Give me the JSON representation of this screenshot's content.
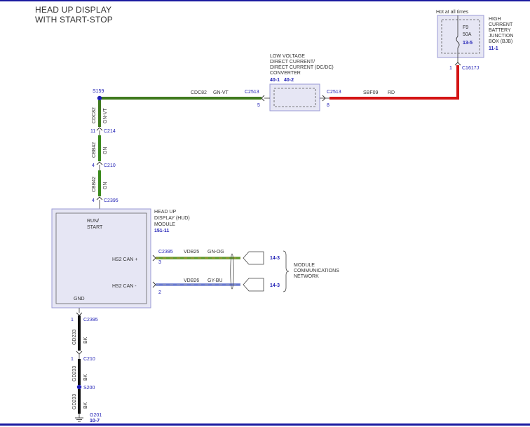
{
  "title": {
    "line1": "HEAD UP DISPLAY",
    "line2": "WITH START-STOP"
  },
  "colors": {
    "frame": "#1a1aa0",
    "component_fill": "#e6e6f4",
    "component_border": "#9a9ad6",
    "ref_text": "#1c1cb4",
    "wire_gn_vt": "#3f7a1e",
    "wire_gn": "#3a8a1c",
    "wire_rd": "#d41414",
    "wire_bk": "#111111",
    "wire_gy_bu": "#6a7ad0",
    "wire_gn_og": "#5f9a2c"
  },
  "bjb": {
    "hot_label": "Hot at all times",
    "fuse": "F9",
    "rating": "50A",
    "fuse_ref": "13-5",
    "name_lines": [
      "HIGH",
      "CURRENT",
      "BATTERY",
      "JUNCTION",
      "BOX (BJB)"
    ],
    "ref": "11-1",
    "pin": "1",
    "connector": "C1617J"
  },
  "converter": {
    "name_lines": [
      "LOW VOLTAGE",
      "DIRECT CURRENT/",
      "DIRECT CURRENT (DC/DC)",
      "CONVERTER"
    ],
    "ref1": "40-1",
    "ref2": "40-2",
    "left_connector": "C2513",
    "left_pin": "5",
    "right_connector": "C2513",
    "right_pin": "8"
  },
  "wires": {
    "red": {
      "circuit": "SBF09",
      "color": "RD"
    },
    "top": {
      "circuit": "CDC82",
      "color": "GN-VT"
    },
    "v1": {
      "circuit": "CDC82",
      "color": "GN-VT"
    },
    "v2": {
      "circuit": "CBB42",
      "color": "GN"
    },
    "v3": {
      "circuit": "CBB42",
      "color": "GN"
    },
    "can_plus": {
      "circuit": "VDB25",
      "color": "GN-OG"
    },
    "can_minus": {
      "circuit": "VDB26",
      "color": "GY-BU"
    },
    "gnd1": {
      "circuit": "GD233",
      "color": "BK"
    },
    "gnd2": {
      "circuit": "GD233",
      "color": "BK"
    },
    "gnd3": {
      "circuit": "GD233",
      "color": "BK"
    }
  },
  "splices": {
    "top": "S159",
    "bottom": "S200"
  },
  "connectors": {
    "c214": {
      "name": "C214",
      "pin": "11"
    },
    "c210_top": {
      "name": "C210",
      "pin": "4"
    },
    "c2395_top": {
      "name": "C2395",
      "pin": "4"
    },
    "c2395_can": {
      "name": "C2395"
    },
    "c2395_bottom": {
      "name": "C2395",
      "pin": "1"
    },
    "c210_bottom": {
      "name": "C210",
      "pin": "1"
    }
  },
  "hud": {
    "name_lines": [
      "HEAD UP",
      "DISPLAY (HUD)",
      "MODULE"
    ],
    "ref": "151-11",
    "run_start_lines": [
      "RUN/",
      "START"
    ],
    "can_plus_label": "HS2 CAN +",
    "can_minus_label": "HS2 CAN -",
    "can_plus_pin": "3",
    "can_minus_pin": "2",
    "gnd_label": "GND"
  },
  "network": {
    "ref_plus": "14-3",
    "ref_minus": "14-3",
    "name_lines": [
      "MODULE",
      "COMMUNICATIONS",
      "NETWORK"
    ]
  },
  "ground": {
    "name": "G201",
    "ref": "10-7"
  }
}
